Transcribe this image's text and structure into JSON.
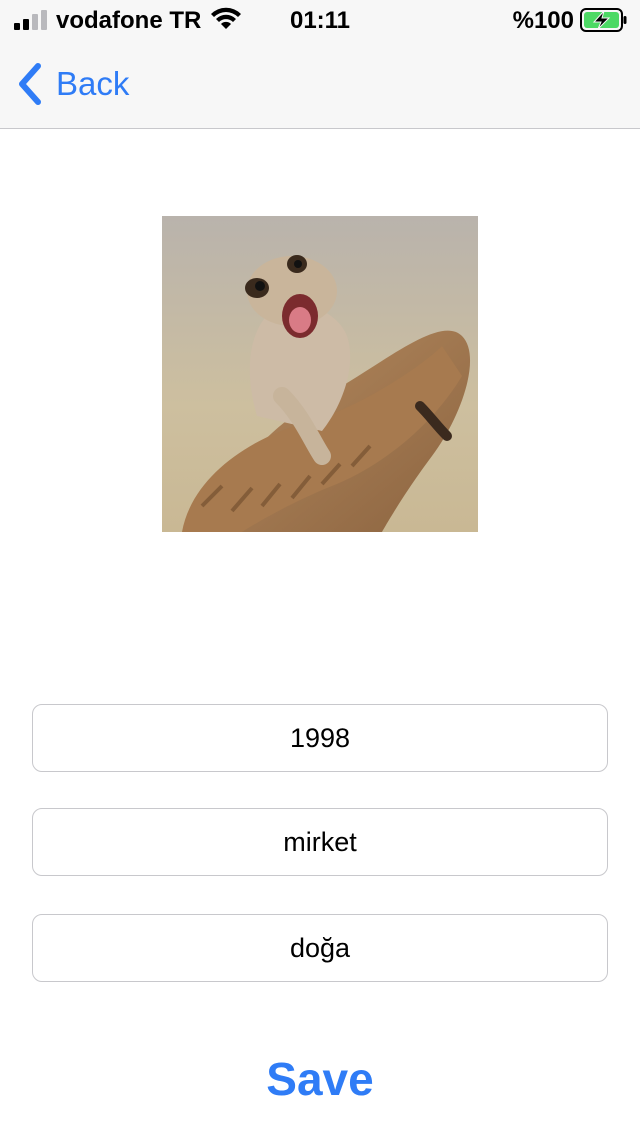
{
  "status_bar": {
    "carrier": "vodafone TR",
    "time": "01:11",
    "battery_text": "%100",
    "battery_level": 1.0,
    "icons": [
      "signal-icon",
      "wifi-icon",
      "battery-charging-icon"
    ]
  },
  "nav": {
    "back_label": "Back",
    "accent_color": "#2f7cf6"
  },
  "photo": {
    "subject": "meerkats"
  },
  "form": {
    "year_value": "1998",
    "name_value": "mirket",
    "category_value": "doğa"
  },
  "actions": {
    "save_label": "Save"
  }
}
